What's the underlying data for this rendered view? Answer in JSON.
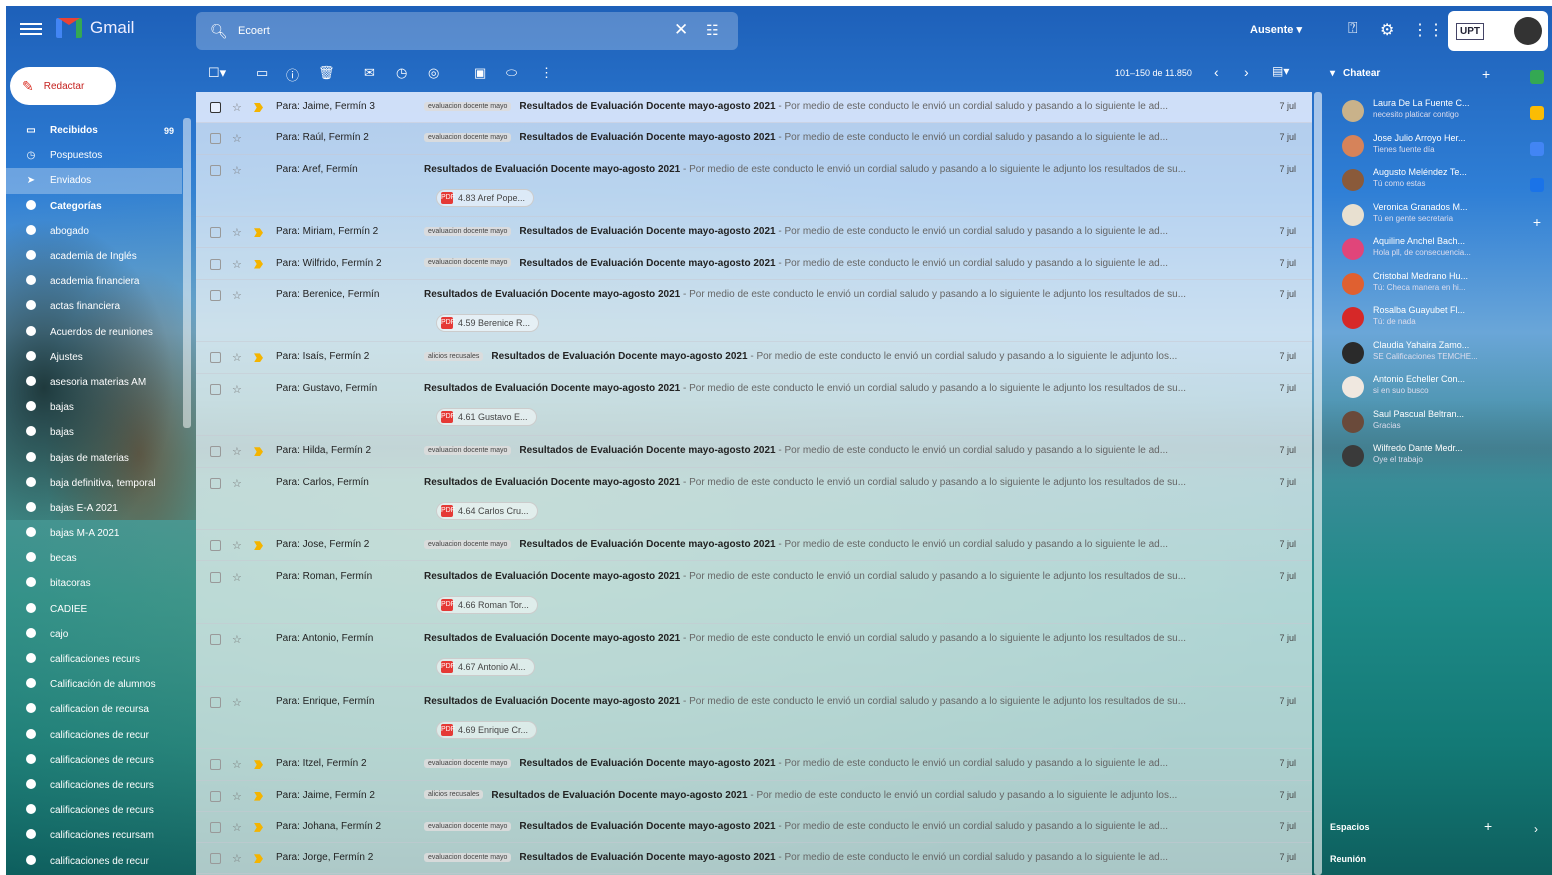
{
  "app": {
    "name": "Gmail"
  },
  "search": {
    "value": "Ecoert"
  },
  "status": {
    "label": "Ausente ▾"
  },
  "account": {
    "badge": "UPT"
  },
  "compose": {
    "label": "Redactar"
  },
  "sidebar": {
    "items": [
      {
        "label": "Recibidos",
        "count": "99",
        "icon": "inbox-icon",
        "bold": true,
        "active": false
      },
      {
        "label": "Pospuestos",
        "count": "",
        "icon": "clock-icon",
        "bold": false,
        "active": false
      },
      {
        "label": "Enviados",
        "count": "",
        "icon": "send-icon",
        "bold": false,
        "active": true
      },
      {
        "label": "Categorías",
        "count": "",
        "icon": "label-icon",
        "bold": true,
        "active": false
      },
      {
        "label": "abogado",
        "count": "",
        "icon": "label-icon",
        "bold": false,
        "active": false
      },
      {
        "label": "academia de Inglés",
        "count": "",
        "icon": "label-icon",
        "bold": false,
        "active": false
      },
      {
        "label": "academia financiera",
        "count": "",
        "icon": "label-icon",
        "bold": false,
        "active": false
      },
      {
        "label": "actas financiera",
        "count": "",
        "icon": "label-icon",
        "bold": false,
        "active": false
      },
      {
        "label": "Acuerdos de reuniones",
        "count": "",
        "icon": "label-icon",
        "bold": false,
        "active": false
      },
      {
        "label": "Ajustes",
        "count": "",
        "icon": "label-icon",
        "bold": false,
        "active": false
      },
      {
        "label": "asesoria materias AM",
        "count": "",
        "icon": "label-icon",
        "bold": false,
        "active": false
      },
      {
        "label": "bajas",
        "count": "",
        "icon": "label-icon",
        "bold": false,
        "active": false
      },
      {
        "label": "bajas",
        "count": "",
        "icon": "label-icon",
        "bold": false,
        "active": false
      },
      {
        "label": "bajas de materias",
        "count": "",
        "icon": "label-icon",
        "bold": false,
        "active": false
      },
      {
        "label": "baja definitiva, temporal",
        "count": "",
        "icon": "label-icon",
        "bold": false,
        "active": false
      },
      {
        "label": "bajas E-A 2021",
        "count": "",
        "icon": "label-icon",
        "bold": false,
        "active": false
      },
      {
        "label": "bajas M-A 2021",
        "count": "",
        "icon": "label-icon",
        "bold": false,
        "active": false
      },
      {
        "label": "becas",
        "count": "",
        "icon": "label-icon",
        "bold": false,
        "active": false
      },
      {
        "label": "bitacoras",
        "count": "",
        "icon": "label-icon",
        "bold": false,
        "active": false
      },
      {
        "label": "CADIEE",
        "count": "",
        "icon": "label-icon",
        "bold": false,
        "active": false
      },
      {
        "label": "cajo",
        "count": "",
        "icon": "label-icon",
        "bold": false,
        "active": false
      },
      {
        "label": "calificaciones recurs",
        "count": "",
        "icon": "label-icon",
        "bold": false,
        "active": false
      },
      {
        "label": "Calificación de alumnos",
        "count": "",
        "icon": "label-icon",
        "bold": false,
        "active": false
      },
      {
        "label": "calificacion de recursa",
        "count": "",
        "icon": "label-icon",
        "bold": false,
        "active": false
      },
      {
        "label": "calificaciones de recur",
        "count": "",
        "icon": "label-icon",
        "bold": false,
        "active": false
      },
      {
        "label": "calificaciones de recurs",
        "count": "",
        "icon": "label-icon",
        "bold": false,
        "active": false
      },
      {
        "label": "calificaciones de recurs",
        "count": "",
        "icon": "label-icon",
        "bold": false,
        "active": false
      },
      {
        "label": "calificaciones de recurs",
        "count": "",
        "icon": "label-icon",
        "bold": false,
        "active": false
      },
      {
        "label": "calificaciones recursam",
        "count": "",
        "icon": "label-icon",
        "bold": false,
        "active": false
      },
      {
        "label": "calificaciones de recur",
        "count": "",
        "icon": "label-icon",
        "bold": false,
        "active": false
      }
    ]
  },
  "toolbar": {
    "pager": "101–150 de 11.850"
  },
  "emails": [
    {
      "from": "Para: Jaime, Fermín 3",
      "tag": "evaluacion docente mayo",
      "subject": "Resultados de Evaluación Docente mayo-agosto 2021",
      "snippet": " - Por medio de este conducto le envió un cordial saludo y pasando a lo siguiente le ad...",
      "date": "7 jul",
      "attachment": "",
      "selected": true,
      "important": true
    },
    {
      "from": "Para: Raúl, Fermín 2",
      "tag": "evaluacion docente mayo",
      "subject": "Resultados de Evaluación Docente mayo-agosto 2021",
      "snippet": " - Por medio de este conducto le envió un cordial saludo y pasando a lo siguiente le ad...",
      "date": "7 jul",
      "attachment": "",
      "selected": false,
      "important": false
    },
    {
      "from": "Para: Aref, Fermín",
      "tag": "",
      "subject": "Resultados de Evaluación Docente mayo-agosto 2021",
      "snippet": " - Por medio de este conducto le envió un cordial saludo y pasando a lo siguiente le adjunto los resultados de su...",
      "date": "7 jul",
      "attachment": "4.83 Aref Pope...",
      "selected": false,
      "important": false
    },
    {
      "from": "Para: Miriam, Fermín 2",
      "tag": "evaluacion docente mayo",
      "subject": "Resultados de Evaluación Docente mayo-agosto 2021",
      "snippet": " - Por medio de este conducto le envió un cordial saludo y pasando a lo siguiente le ad...",
      "date": "7 jul",
      "attachment": "",
      "selected": false,
      "important": true
    },
    {
      "from": "Para: Wilfrido, Fermín 2",
      "tag": "evaluacion docente mayo",
      "subject": "Resultados de Evaluación Docente mayo-agosto 2021",
      "snippet": " - Por medio de este conducto le envió un cordial saludo y pasando a lo siguiente le ad...",
      "date": "7 jul",
      "attachment": "",
      "selected": false,
      "important": true
    },
    {
      "from": "Para: Berenice, Fermín",
      "tag": "",
      "subject": "Resultados de Evaluación Docente mayo-agosto 2021",
      "snippet": " - Por medio de este conducto le envió un cordial saludo y pasando a lo siguiente le adjunto los resultados de su...",
      "date": "7 jul",
      "attachment": "4.59 Berenice R...",
      "selected": false,
      "important": false
    },
    {
      "from": "Para: Isaís, Fermín 2",
      "tag": "alicios recusales",
      "subject": "Resultados de Evaluación Docente mayo-agosto 2021",
      "snippet": " - Por medio de este conducto le envió un cordial saludo y pasando a lo siguiente le adjunto los...",
      "date": "7 jul",
      "attachment": "",
      "selected": false,
      "important": true
    },
    {
      "from": "Para: Gustavo, Fermín",
      "tag": "",
      "subject": "Resultados de Evaluación Docente mayo-agosto 2021",
      "snippet": " - Por medio de este conducto le envió un cordial saludo y pasando a lo siguiente le adjunto los resultados de su...",
      "date": "7 jul",
      "attachment": "4.61 Gustavo E...",
      "selected": false,
      "important": false
    },
    {
      "from": "Para: Hilda, Fermín 2",
      "tag": "evaluacion docente mayo",
      "subject": "Resultados de Evaluación Docente mayo-agosto 2021",
      "snippet": " - Por medio de este conducto le envió un cordial saludo y pasando a lo siguiente le ad...",
      "date": "7 jul",
      "attachment": "",
      "selected": false,
      "important": true
    },
    {
      "from": "Para: Carlos, Fermín",
      "tag": "",
      "subject": "Resultados de Evaluación Docente mayo-agosto 2021",
      "snippet": " - Por medio de este conducto le envió un cordial saludo y pasando a lo siguiente le adjunto los resultados de su...",
      "date": "7 jul",
      "attachment": "4.64 Carlos Cru...",
      "selected": false,
      "important": false
    },
    {
      "from": "Para: Jose, Fermín 2",
      "tag": "evaluacion docente mayo",
      "subject": "Resultados de Evaluación Docente mayo-agosto 2021",
      "snippet": " - Por medio de este conducto le envió un cordial saludo y pasando a lo siguiente le ad...",
      "date": "7 jul",
      "attachment": "",
      "selected": false,
      "important": true
    },
    {
      "from": "Para: Roman, Fermín",
      "tag": "",
      "subject": "Resultados de Evaluación Docente mayo-agosto 2021",
      "snippet": " - Por medio de este conducto le envió un cordial saludo y pasando a lo siguiente le adjunto los resultados de su...",
      "date": "7 jul",
      "attachment": "4.66 Roman Tor...",
      "selected": false,
      "important": false
    },
    {
      "from": "Para: Antonio, Fermín",
      "tag": "",
      "subject": "Resultados de Evaluación Docente mayo-agosto 2021",
      "snippet": " - Por medio de este conducto le envió un cordial saludo y pasando a lo siguiente le adjunto los resultados de su...",
      "date": "7 jul",
      "attachment": "4.67 Antonio Al...",
      "selected": false,
      "important": false
    },
    {
      "from": "Para: Enrique, Fermín",
      "tag": "",
      "subject": "Resultados de Evaluación Docente mayo-agosto 2021",
      "snippet": " - Por medio de este conducto le envió un cordial saludo y pasando a lo siguiente le adjunto los resultados de su...",
      "date": "7 jul",
      "attachment": "4.69 Enrique Cr...",
      "selected": false,
      "important": false
    },
    {
      "from": "Para: Itzel, Fermín 2",
      "tag": "evaluacion docente mayo",
      "subject": "Resultados de Evaluación Docente mayo-agosto 2021",
      "snippet": " - Por medio de este conducto le envió un cordial saludo y pasando a lo siguiente le ad...",
      "date": "7 jul",
      "attachment": "",
      "selected": false,
      "important": true
    },
    {
      "from": "Para: Jaime, Fermín 2",
      "tag": "alicios recusales",
      "subject": "Resultados de Evaluación Docente mayo-agosto 2021",
      "snippet": " - Por medio de este conducto le envió un cordial saludo y pasando a lo siguiente le adjunto los...",
      "date": "7 jul",
      "attachment": "",
      "selected": false,
      "important": true
    },
    {
      "from": "Para: Johana, Fermín 2",
      "tag": "evaluacion docente mayo",
      "subject": "Resultados de Evaluación Docente mayo-agosto 2021",
      "snippet": " - Por medio de este conducto le envió un cordial saludo y pasando a lo siguiente le ad...",
      "date": "7 jul",
      "attachment": "",
      "selected": false,
      "important": true
    },
    {
      "from": "Para: Jorge, Fermín 2",
      "tag": "evaluacion docente mayo",
      "subject": "Resultados de Evaluación Docente mayo-agosto 2021",
      "snippet": " - Por medio de este conducto le envió un cordial saludo y pasando a lo siguiente le ad...",
      "date": "7 jul",
      "attachment": "",
      "selected": false,
      "important": true
    }
  ],
  "chat": {
    "title": "Chatear",
    "contacts": [
      {
        "name": "Laura De La Fuente C...",
        "status": "necesito platicar contigo",
        "color": "#c9b28a"
      },
      {
        "name": "Jose Julio Arroyo Her...",
        "status": "Tienes fuente día",
        "color": "#d6835a"
      },
      {
        "name": "Augusto Meléndez Te...",
        "status": "Tú como estas",
        "color": "#8a5a3a"
      },
      {
        "name": "Veronica Granados M...",
        "status": "Tú en gente secretaria",
        "color": "#e8e0d0"
      },
      {
        "name": "Aquiline Anchel Bach...",
        "status": "Hola pll, de consecuencia...",
        "color": "#e0457a"
      },
      {
        "name": "Cristobal Medrano Hu...",
        "status": "Tú: Checa manera en hi...",
        "color": "#e06030"
      },
      {
        "name": "Rosalba Guayubet Fl...",
        "status": "Tú: de nada",
        "color": "#d62828"
      },
      {
        "name": "Claudia Yahaira Zamo...",
        "status": "SE Calificaciones TEMCHE...",
        "color": "#2a2a2a"
      },
      {
        "name": "Antonio Echeller Con...",
        "status": "si en suo busco",
        "color": "#f0e8e0"
      },
      {
        "name": "Saul Pascual Beltran...",
        "status": "Gracias",
        "color": "#6a4a3a"
      },
      {
        "name": "Wilfredo Dante Medr...",
        "status": "Oye el trabajo",
        "color": "#3a3a3a"
      }
    ],
    "spaces": "Espacios",
    "meeting": "Reunión"
  },
  "colors": {
    "accent": "#1a73e8",
    "compose_text": "#c5221f",
    "important": "#f4b400"
  }
}
